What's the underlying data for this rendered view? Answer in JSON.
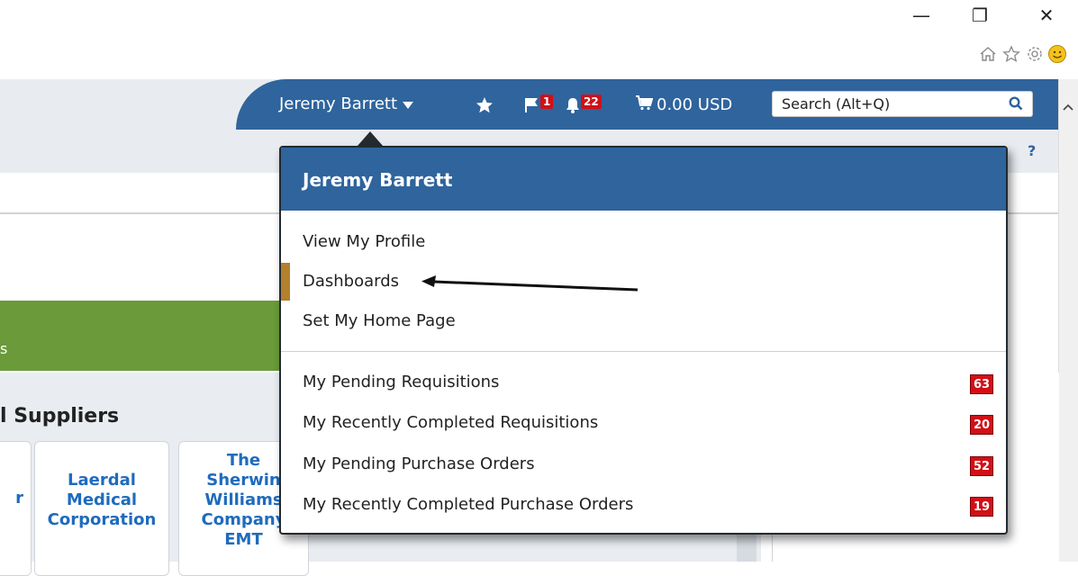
{
  "window": {
    "minimize": "—",
    "restore": "❐",
    "close": "✕"
  },
  "browser_toolbar": {
    "icons": [
      "home-icon",
      "favorites-star-icon",
      "settings-gear-icon",
      "smiley-feedback-icon"
    ]
  },
  "header": {
    "user_name": "Jeremy Barrett",
    "flag_count": "1",
    "notification_count": "22",
    "cart_total": "0.00 USD",
    "search_placeholder": "Search (Alt+Q)",
    "help": "?"
  },
  "background": {
    "green_band_text": "s",
    "suppliers_title": "l Suppliers",
    "cards": [
      {
        "text": "r"
      },
      {
        "text": "Laerdal Medical Corporation"
      },
      {
        "text": "The Sherwin Williams Company EMT"
      }
    ]
  },
  "dropdown": {
    "title": "Jeremy Barrett",
    "items": [
      "View My Profile",
      "Dashboards",
      "Set My Home Page"
    ],
    "active_item": "Dashboards",
    "counted_items": [
      {
        "label": "My Pending Requisitions",
        "count": "63"
      },
      {
        "label": "My Recently Completed Requisitions",
        "count": "20"
      },
      {
        "label": "My Pending Purchase Orders",
        "count": "52"
      },
      {
        "label": "My Recently Completed Purchase Orders",
        "count": "19"
      }
    ]
  },
  "colors": {
    "brand_blue": "#2f649d",
    "badge_red": "#d20f16",
    "active_marker": "#b3802d",
    "green_band": "#6a9a3a",
    "supplier_link": "#1f6bbd"
  }
}
